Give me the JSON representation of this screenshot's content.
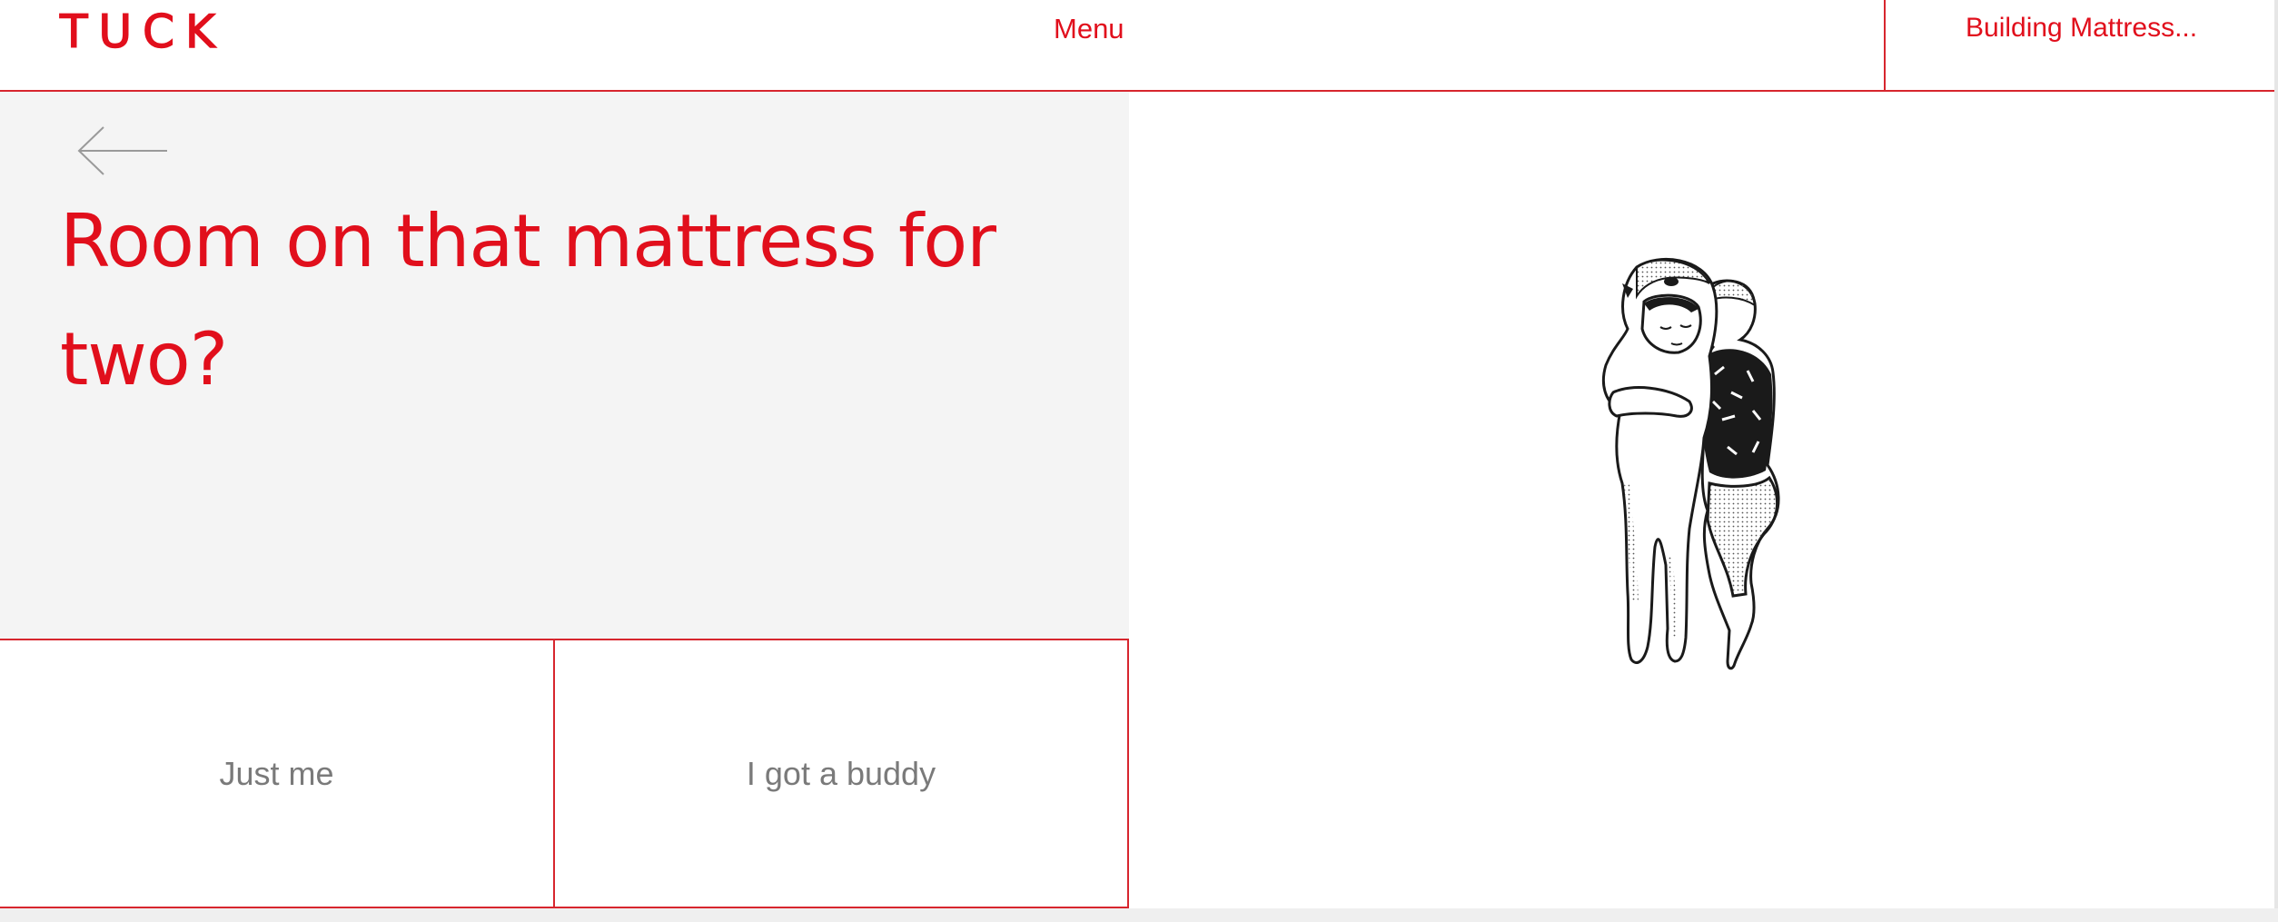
{
  "header": {
    "logo": "TUCK",
    "menu_label": "Menu",
    "progress_label": "Building Mattress..."
  },
  "question": {
    "title": "Room on that mattress for two?",
    "back_icon": "arrow-left-icon"
  },
  "options": [
    {
      "label": "Just me"
    },
    {
      "label": "I got a buddy"
    }
  ],
  "illustration": {
    "icon": "cuddling-couple-illustration"
  },
  "colors": {
    "accent": "#e10f1c",
    "border": "#d7262e",
    "panel_bg": "#f4f4f4",
    "option_text": "#7a7a7a"
  }
}
